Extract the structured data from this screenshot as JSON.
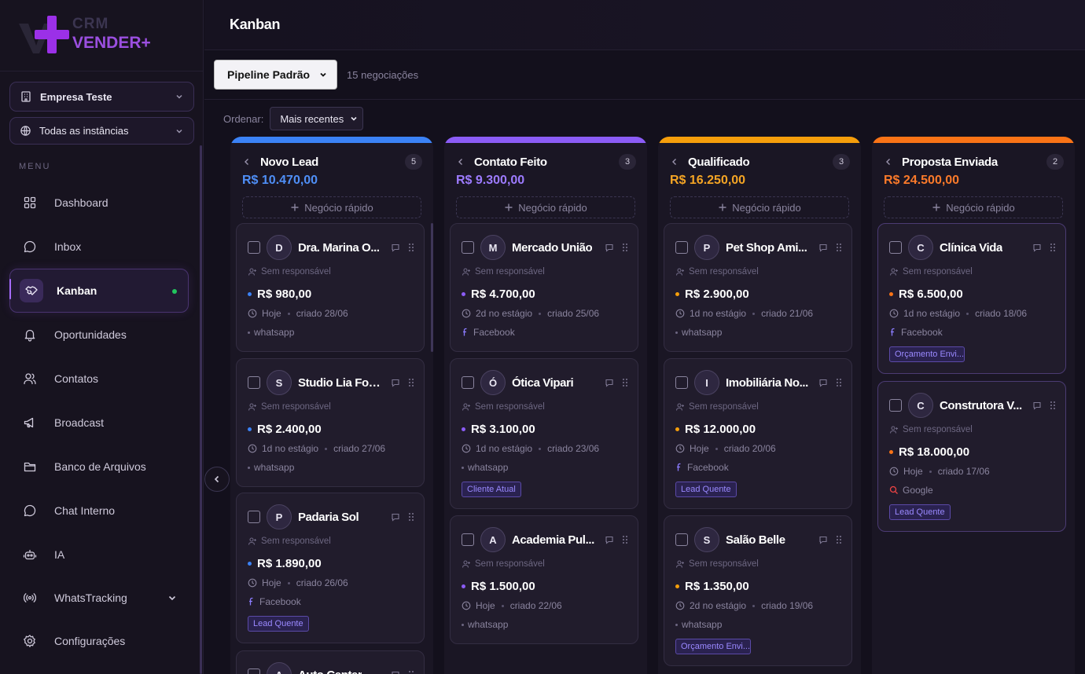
{
  "brand": {
    "line1": "CRM",
    "line2": "VENDER+"
  },
  "company_select": {
    "label": "Empresa Teste",
    "icon": "building-icon"
  },
  "instance_select": {
    "label": "Todas as instâncias",
    "icon": "globe-icon"
  },
  "menu_label": "MENU",
  "nav": [
    {
      "label": "Dashboard",
      "icon": "dashboard-icon"
    },
    {
      "label": "Inbox",
      "icon": "chat-bubble-icon"
    },
    {
      "label": "Kanban",
      "icon": "handshake-icon",
      "active": true
    },
    {
      "label": "Oportunidades",
      "icon": "bell-icon"
    },
    {
      "label": "Contatos",
      "icon": "users-icon"
    },
    {
      "label": "Broadcast",
      "icon": "megaphone-icon"
    },
    {
      "label": "Banco de Arquivos",
      "icon": "folder-icon"
    },
    {
      "label": "Chat Interno",
      "icon": "chat-bubble-icon"
    },
    {
      "label": "IA",
      "icon": "robot-icon"
    },
    {
      "label": "WhatsTracking",
      "icon": "broadcast-signal-icon",
      "expandable": true
    },
    {
      "label": "Configurações",
      "icon": "gear-icon"
    }
  ],
  "page_title": "Kanban",
  "pipeline": {
    "selected": "Pipeline Padrão"
  },
  "deal_count": "15 negociações",
  "sort": {
    "label": "Ordenar:",
    "selected": "Mais recentes"
  },
  "quick_add_label": "Negócio rápido",
  "no_owner_label": "Sem responsável",
  "colors": {
    "blue": "#3b82f6",
    "purple": "#8b5cf6",
    "amber": "#f59e0b",
    "orange": "#f97316",
    "accent": "#a66cff"
  },
  "columns": [
    {
      "name": "Novo Lead",
      "count": "5",
      "total": "R$ 10.470,00",
      "color": "#3b82f6",
      "text_color": "#4f8ff7",
      "cards": [
        {
          "initial": "D",
          "name": "Dra. Marina O...",
          "value": "R$ 980,00",
          "age": "Hoje",
          "created": "criado 28/06",
          "source": "whatsapp",
          "source_icon": "dot"
        },
        {
          "initial": "S",
          "name": "Studio Lia Fot...",
          "value": "R$ 2.400,00",
          "age": "1d no estágio",
          "created": "criado 27/06",
          "source": "whatsapp",
          "source_icon": "dot"
        },
        {
          "initial": "P",
          "name": "Padaria Sol",
          "value": "R$ 1.890,00",
          "age": "Hoje",
          "created": "criado 26/06",
          "source": "Facebook",
          "source_icon": "facebook-icon",
          "tag": "Lead Quente"
        },
        {
          "initial": "A",
          "name": "Auto Center",
          "value": "",
          "age": "",
          "created": "",
          "source": "",
          "source_icon": "dot"
        }
      ]
    },
    {
      "name": "Contato Feito",
      "count": "3",
      "total": "R$ 9.300,00",
      "color": "#8b5cf6",
      "text_color": "#9d7bff",
      "cards": [
        {
          "initial": "M",
          "name": "Mercado União",
          "value": "R$ 4.700,00",
          "age": "2d no estágio",
          "created": "criado 25/06",
          "source": "Facebook",
          "source_icon": "facebook-icon"
        },
        {
          "initial": "Ó",
          "name": "Ótica Vipari",
          "value": "R$ 3.100,00",
          "age": "1d no estágio",
          "created": "criado 23/06",
          "source": "whatsapp",
          "source_icon": "dot",
          "tag": "Cliente Atual"
        },
        {
          "initial": "A",
          "name": "Academia Pul...",
          "value": "R$ 1.500,00",
          "age": "Hoje",
          "created": "criado 22/06",
          "source": "whatsapp",
          "source_icon": "dot"
        }
      ]
    },
    {
      "name": "Qualificado",
      "count": "3",
      "total": "R$ 16.250,00",
      "color": "#f59e0b",
      "text_color": "#f5a524",
      "cards": [
        {
          "initial": "P",
          "name": "Pet Shop Ami...",
          "value": "R$ 2.900,00",
          "age": "1d no estágio",
          "created": "criado 21/06",
          "source": "whatsapp",
          "source_icon": "dot"
        },
        {
          "initial": "I",
          "name": "Imobiliária No...",
          "value": "R$ 12.000,00",
          "age": "Hoje",
          "created": "criado 20/06",
          "source": "Facebook",
          "source_icon": "facebook-icon",
          "tag": "Lead Quente"
        },
        {
          "initial": "S",
          "name": "Salão Belle",
          "value": "R$ 1.350,00",
          "age": "2d no estágio",
          "created": "criado 19/06",
          "source": "whatsapp",
          "source_icon": "dot",
          "tag": "Orçamento Envi..."
        }
      ]
    },
    {
      "name": "Proposta Enviada",
      "count": "2",
      "total": "R$ 24.500,00",
      "color": "#f97316",
      "text_color": "#fb7a2a",
      "cards": [
        {
          "initial": "C",
          "name": "Clínica Vida",
          "value": "R$ 6.500,00",
          "age": "1d no estágio",
          "created": "criado 18/06",
          "source": "Facebook",
          "source_icon": "facebook-icon",
          "tag": "Orçamento Envi..."
        },
        {
          "initial": "C",
          "name": "Construtora V...",
          "value": "R$ 18.000,00",
          "age": "Hoje",
          "created": "criado 17/06",
          "source": "Google",
          "source_icon": "search-icon",
          "tag": "Lead Quente"
        }
      ]
    }
  ]
}
